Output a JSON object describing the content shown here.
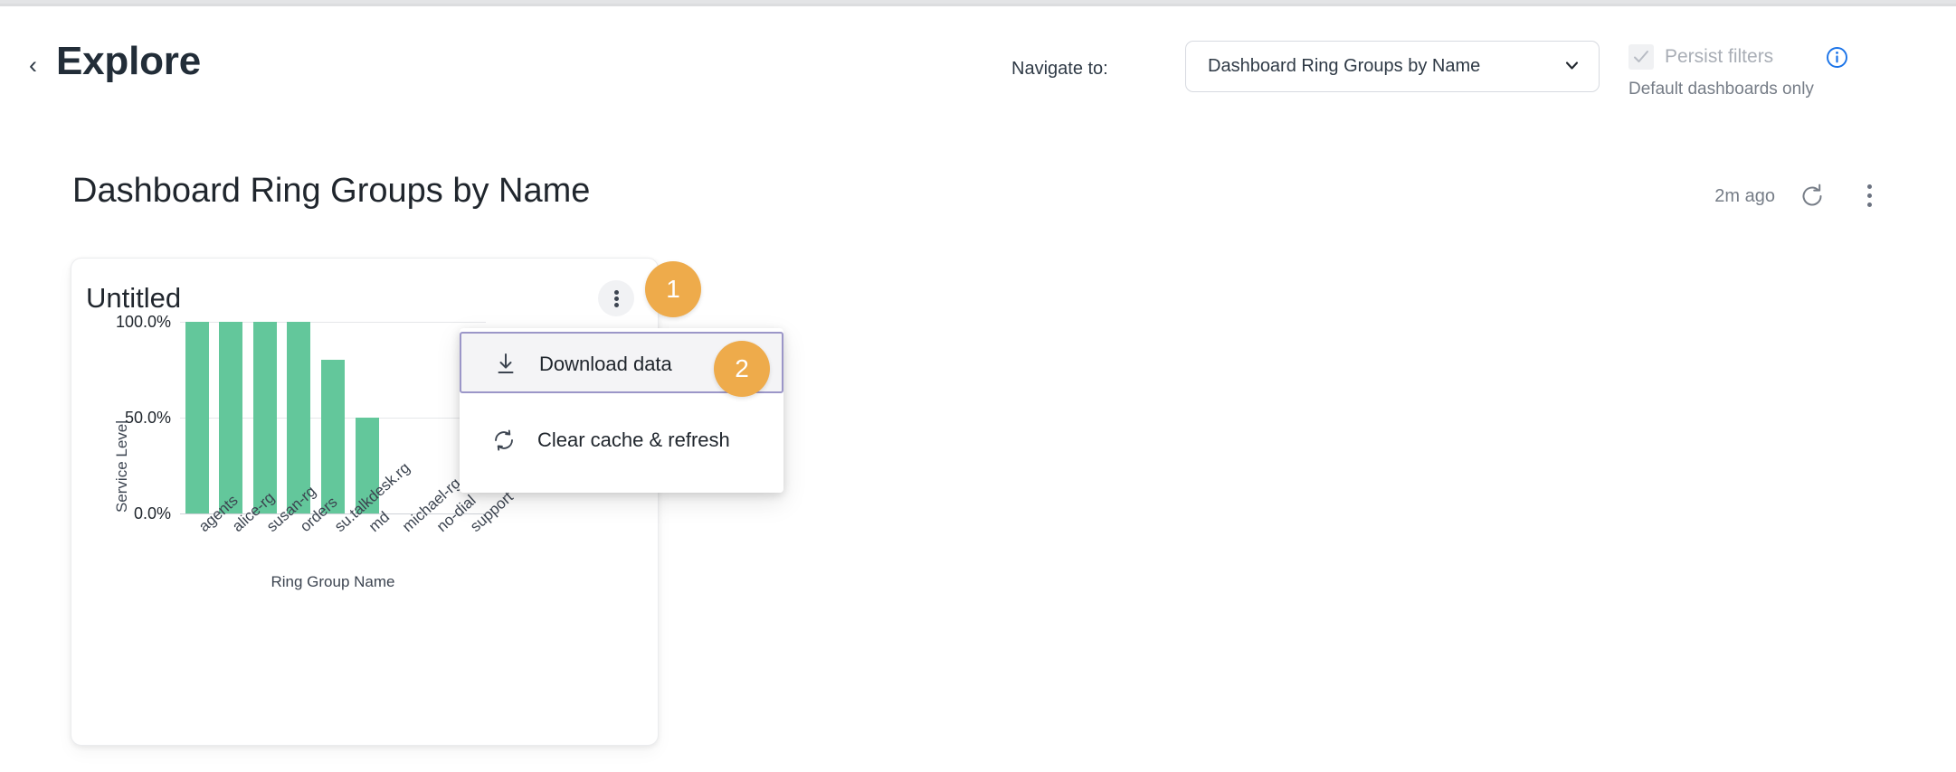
{
  "header": {
    "back_icon": "chevron-left-icon",
    "title": "Explore",
    "navigate_label": "Navigate to:",
    "navigate_value": "Dashboard Ring Groups by Name",
    "persist_filters_label": "Persist filters",
    "persist_filters_checked": true,
    "persist_filters_disabled": true,
    "persist_sub_label": "Default dashboards only",
    "info_icon": "info-icon",
    "info_icon_color": "#1a73e8"
  },
  "dashboard": {
    "title": "Dashboard Ring Groups by Name",
    "last_refreshed": "2m ago",
    "refresh_icon": "refresh-icon",
    "kebab_icon": "more-vertical-icon"
  },
  "widget": {
    "title": "Untitled",
    "kebab_icon": "more-vertical-icon"
  },
  "context_menu": {
    "items": [
      {
        "label": "Download data",
        "icon": "download-icon",
        "focused": true
      },
      {
        "label": "Clear cache & refresh",
        "icon": "refresh-cycle-icon",
        "focused": false
      }
    ]
  },
  "annotations": [
    {
      "number": "1",
      "target": "widget-kebab-button"
    },
    {
      "number": "2",
      "target": "download-data-menu-item"
    }
  ],
  "colors": {
    "bar_green": "#63c79b",
    "badge_orange": "#eeab4b",
    "focus_purple": "#9b96c8",
    "info_blue": "#1a73e8"
  },
  "chart_data": {
    "type": "bar",
    "title": "Untitled",
    "xlabel": "Ring Group Name",
    "ylabel": "Service Level",
    "categories": [
      "agents",
      "alice-rg",
      "susan-rg",
      "orders",
      "su.talkdesk.rg",
      "md",
      "michael-rg",
      "no-dial",
      "support"
    ],
    "values": [
      100,
      100,
      100,
      100,
      80,
      50,
      0,
      0,
      0
    ],
    "ylim": [
      0,
      100
    ],
    "yticks": [
      0,
      50,
      100
    ],
    "ytick_labels": [
      "0.0%",
      "50.0%",
      "100.0%"
    ],
    "grid": true,
    "legend": false,
    "series": [
      {
        "name": "Service Level",
        "values": [
          100,
          100,
          100,
          100,
          80,
          50,
          0,
          0,
          0
        ],
        "color": "#63c79b"
      }
    ]
  }
}
